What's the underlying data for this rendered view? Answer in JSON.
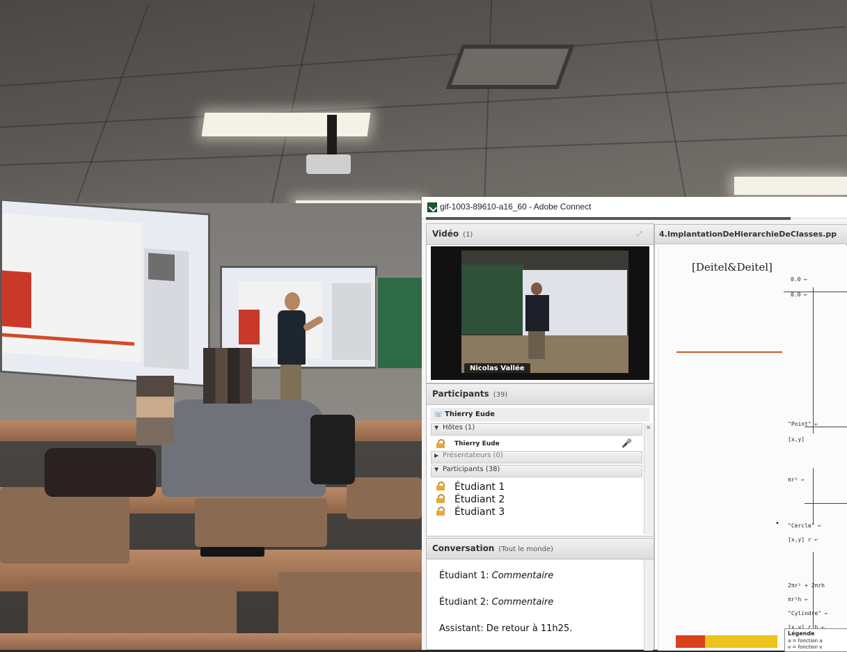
{
  "window": {
    "title": "gif-1003-89610-a16_60 - Adobe Connect"
  },
  "video_pod": {
    "title": "Vidéo",
    "count": "(1)",
    "speaker_label": "Nicolas Vallée"
  },
  "participants_pod": {
    "title": "Participants",
    "count": "(39)",
    "current_user": "Thierry Eude",
    "groups": [
      {
        "label": "Hôtes (1)",
        "expanded": true
      },
      {
        "label": "Présentateurs (0)",
        "expanded": false
      },
      {
        "label": "Participants (38)",
        "expanded": true
      }
    ],
    "hosts": [
      "Thierry Eude"
    ],
    "students": [
      "Étudiant 1",
      "Étudiant 2",
      "Étudiant 3"
    ]
  },
  "chat_pod": {
    "title": "Conversation",
    "scope": "(Tout le monde)",
    "messages": [
      {
        "sender": "Étudiant 1:",
        "text": "Commentaire",
        "italic": true
      },
      {
        "sender": "Étudiant 2:",
        "text": "Commentaire",
        "italic": true
      },
      {
        "sender": "Assistant:",
        "text": "De retour à 11h25.",
        "italic": false
      }
    ]
  },
  "share_pod": {
    "title": "4.ImplantationDeHierarchieDeClasses.pp",
    "slide": {
      "citation": "[Deitel&Deitel]",
      "code_lines": [
        "0.0 ←",
        "0.0 ←",
        "\"Point\" ←",
        "[x,y]",
        "πr² ←",
        "\"Cercle\" ←",
        "[x,y] r ←",
        "2πr² + 2πrh",
        "πr²h ←",
        "\"Cylindre\" ←",
        "[x,y] r h ←"
      ],
      "legend_title": "Légende",
      "legend_lines": [
        "a = fonction a",
        "v = fonction v"
      ]
    }
  },
  "colors": {
    "accent_red": "#d8401e",
    "accent_yellow": "#ecc21c",
    "chalkboard_green": "#2d6a45"
  },
  "icons": {
    "window_icon": "adobe-connect-icon",
    "expand": "expand-icon",
    "phone_user": "phone-user-icon",
    "host": "lock-icon",
    "audio": "microphone-icon"
  }
}
